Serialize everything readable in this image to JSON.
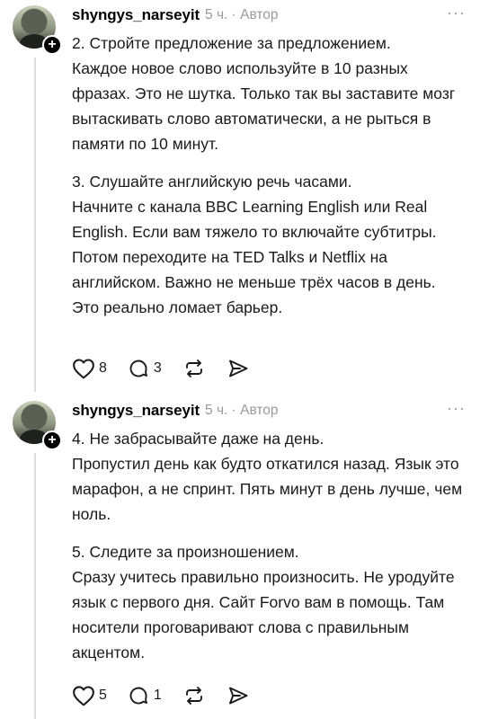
{
  "posts": [
    {
      "username": "shyngys_narseyit",
      "time": "5 ч.",
      "separator": "·",
      "role": "Автор",
      "more": "···",
      "paragraphs": [
        {
          "heading": "2. Стройте предложение за предложением.",
          "text": "Каждое новое слово используйте в 10 разных фразах. Это не шутка. Только так вы заставите мозг вытаскивать слово автоматически, а не рыться в памяти по 10 минут."
        },
        {
          "heading": "3. Слушайте английскую речь часами.",
          "text": "Начните с канала BBC Learning English или Real English. Если вам тяжело то включайте субтитры. Потом переходите на TED Talks и Netflix на английском. Важно не меньше трёх часов в день. Это реально ломает барьер."
        }
      ],
      "likes": "8",
      "replies": "3",
      "reposts": "",
      "icons": [
        "heart-icon",
        "reply-icon",
        "repost-icon",
        "share-icon"
      ]
    },
    {
      "username": "shyngys_narseyit",
      "time": "5 ч.",
      "separator": "·",
      "role": "Автор",
      "more": "···",
      "paragraphs": [
        {
          "heading": "4. Не забрасывайте даже на день.",
          "text": "Пропустил день как будто откатился назад. Язык это марафон, а не спринт. Пять минут в день лучше, чем ноль."
        },
        {
          "heading": "5. Следите за произношением.",
          "text": "Сразу учитесь правильно произносить. Не уродуйте язык с первого дня. Сайт Forvo вам в помощь. Там носители проговаривают слова с правильным акцентом."
        }
      ],
      "likes": "5",
      "replies": "1",
      "reposts": "",
      "icons": [
        "heart-icon",
        "reply-icon",
        "repost-icon",
        "share-icon"
      ]
    }
  ]
}
